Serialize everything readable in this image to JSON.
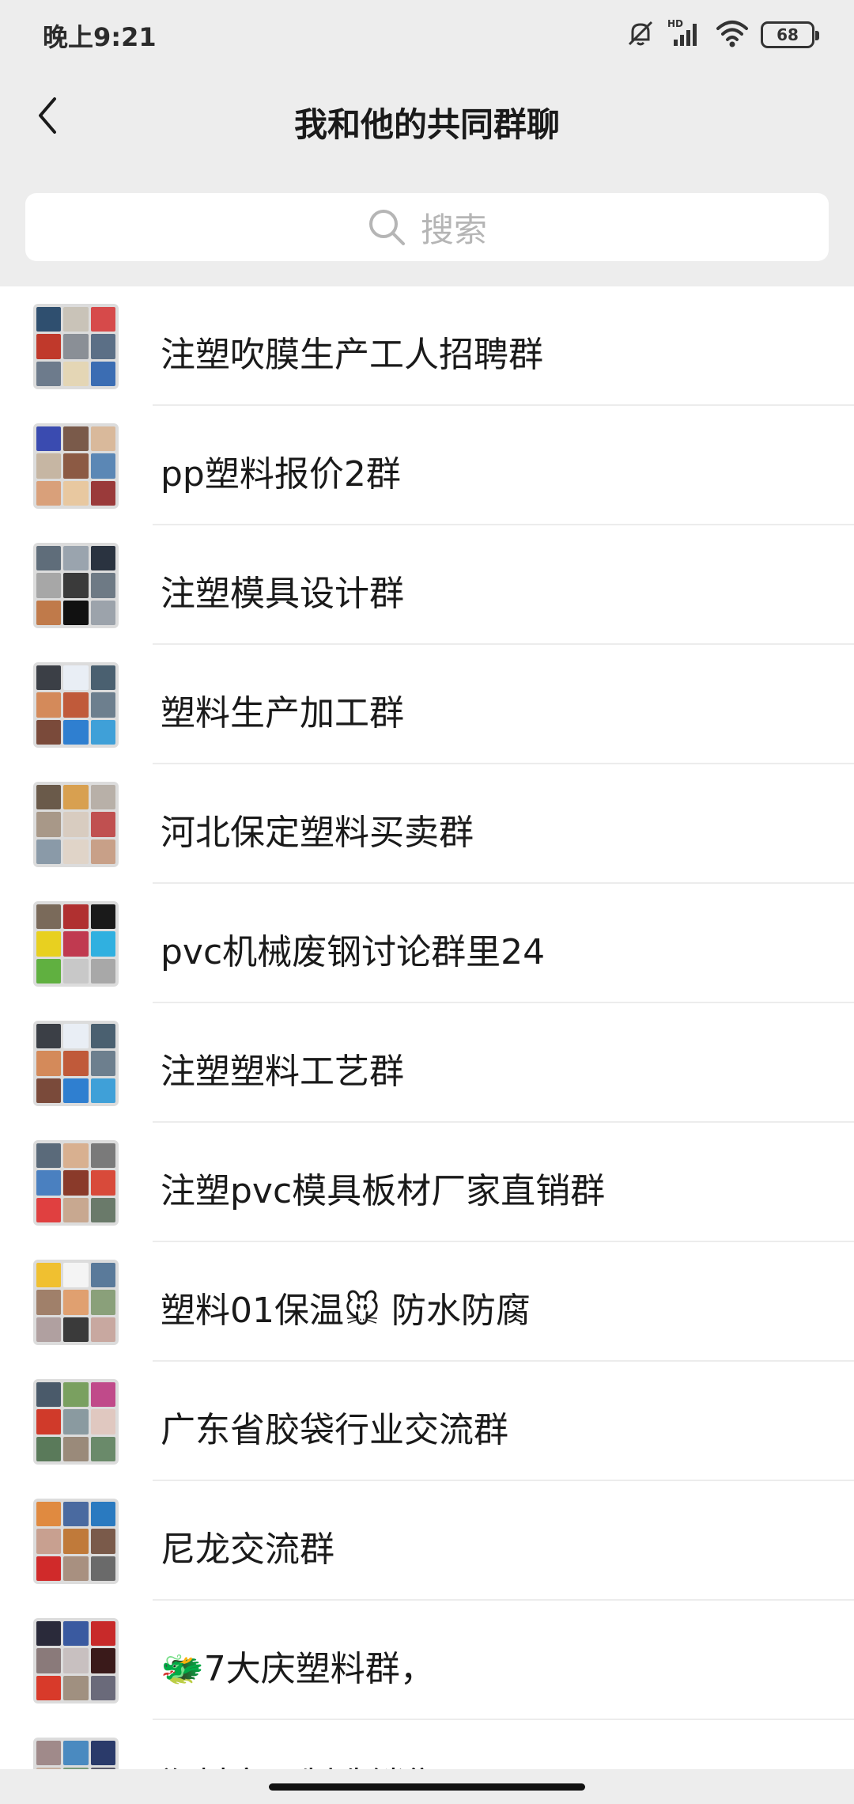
{
  "status_bar": {
    "time": "晚上9:21",
    "hd_label": "HD",
    "battery": "68",
    "icons": [
      "mute-icon",
      "signal-icon",
      "wifi-icon",
      "battery-icon"
    ]
  },
  "header": {
    "title": "我和他的共同群聊",
    "back_icon": "chevron-left-icon"
  },
  "search": {
    "placeholder": "搜索",
    "icon": "search-icon"
  },
  "groups": [
    {
      "name": "注塑吹膜生产工人招聘群"
    },
    {
      "name": "pp塑料报价2群"
    },
    {
      "name": "注塑模具设计群"
    },
    {
      "name": "塑料生产加工群"
    },
    {
      "name": "河北保定塑料买卖群"
    },
    {
      "name": "pvc机械废钢讨论群里24"
    },
    {
      "name": "注塑塑料工艺群"
    },
    {
      "name": "注塑pvc模具板材厂家直销群"
    },
    {
      "name": "塑料01保温🐭 防水防腐"
    },
    {
      "name": "广东省胶袋行业交流群"
    },
    {
      "name": "尼龙交流群"
    },
    {
      "name": "🐲7大庆塑料群，"
    },
    {
      "name": "塑料交易制造销售"
    }
  ],
  "colors": {
    "background": "#ededed",
    "list_background": "#ffffff",
    "text": "#1a1a1a",
    "placeholder": "#b5b5b5",
    "divider": "#ececec"
  }
}
